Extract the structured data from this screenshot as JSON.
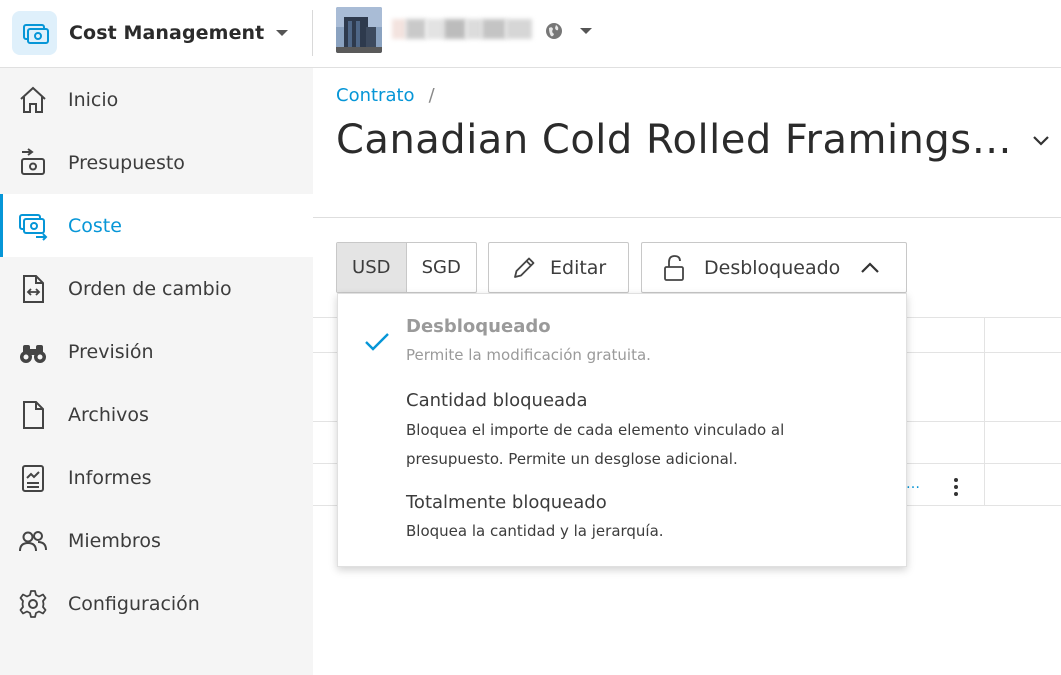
{
  "header": {
    "app_name": "Cost Management",
    "app_icon": "cost-management-icon",
    "project_icon": "globe-icon"
  },
  "sidebar": {
    "items": [
      {
        "label": "Inicio",
        "icon": "home-icon"
      },
      {
        "label": "Presupuesto",
        "icon": "budget-icon"
      },
      {
        "label": "Coste",
        "icon": "cost-icon",
        "active": true
      },
      {
        "label": "Orden de cambio",
        "icon": "change-order-icon"
      },
      {
        "label": "Previsión",
        "icon": "binoculars-icon"
      },
      {
        "label": "Archivos",
        "icon": "file-icon"
      },
      {
        "label": "Informes",
        "icon": "report-icon"
      },
      {
        "label": "Miembros",
        "icon": "members-icon"
      },
      {
        "label": "Configuración",
        "icon": "gear-icon"
      }
    ]
  },
  "main": {
    "breadcrumb": {
      "link": "Contrato",
      "separator": "/"
    },
    "title": "Canadian Cold Rolled Framings…",
    "toolbar": {
      "currencies": [
        "USD",
        "SGD"
      ],
      "selected_currency": "USD",
      "edit_label": "Editar",
      "lock_label": "Desbloqueado"
    },
    "table": {
      "truncated_link": "…"
    },
    "lock_menu": {
      "options": [
        {
          "title": "Desbloqueado",
          "desc": "Permite la modificación gratuita.",
          "selected": true
        },
        {
          "title": "Cantidad bloqueada",
          "desc": "Bloquea el importe de cada elemento vinculado al presupuesto. Permite un desglose adicional.",
          "selected": false
        },
        {
          "title": "Totalmente bloqueado",
          "desc": "Bloquea la cantidad y la jerarquía.",
          "selected": false
        }
      ]
    }
  },
  "colors": {
    "accent": "#0696d7",
    "sidebar_bg": "#f5f5f5",
    "text": "#3c3c3c",
    "muted": "#9a9a9a"
  }
}
